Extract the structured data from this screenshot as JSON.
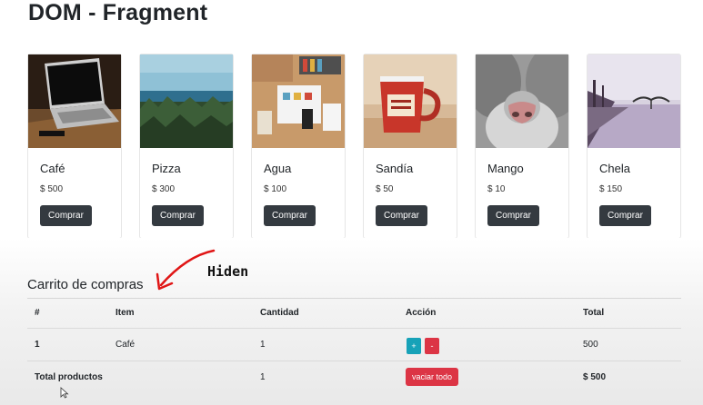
{
  "page": {
    "title": "DOM - Fragment"
  },
  "products": [
    {
      "name": "Café",
      "price": "$ 500",
      "button": "Comprar",
      "image": "laptop-photo"
    },
    {
      "name": "Pizza",
      "price": "$ 300",
      "button": "Comprar",
      "image": "forest-photo"
    },
    {
      "name": "Agua",
      "price": "$ 100",
      "button": "Comprar",
      "image": "desk-photo"
    },
    {
      "name": "Sandía",
      "price": "$ 50",
      "button": "Comprar",
      "image": "mug-photo"
    },
    {
      "name": "Mango",
      "price": "$ 10",
      "button": "Comprar",
      "image": "cat-nose-photo"
    },
    {
      "name": "Chela",
      "price": "$ 150",
      "button": "Comprar",
      "image": "pier-photo"
    }
  ],
  "cart": {
    "title": "Carrito de compras",
    "annotation": "Hiden",
    "headers": [
      "#",
      "Item",
      "Cantidad",
      "Acción",
      "Total"
    ],
    "rows": [
      {
        "id": "1",
        "item": "Café",
        "qty": "1",
        "plus": "+",
        "minus": "-",
        "total": "500"
      }
    ],
    "footer": {
      "label": "Total productos",
      "qty": "1",
      "clear_button": "vaciar todo",
      "total": "$ 500"
    }
  },
  "colors": {
    "dark_button": "#343a40",
    "info_button": "#17a2b8",
    "danger_button": "#dc3545",
    "annotation_arrow": "#e01515"
  }
}
